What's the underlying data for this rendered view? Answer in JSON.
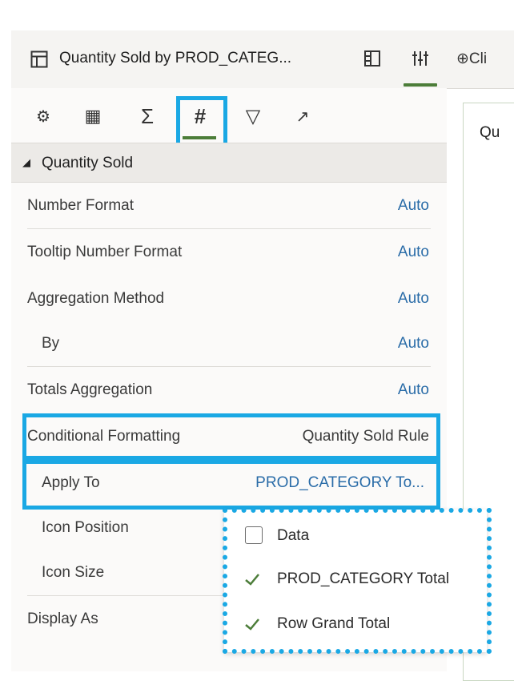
{
  "titlebar": {
    "title": "Quantity Sold by PROD_CATEG...",
    "icons": [
      "table-icon",
      "panel-layout-icon",
      "properties-sliders-icon"
    ]
  },
  "right_strip": {
    "add_text": "⊕Cli",
    "canvas_title_partial": "Qu"
  },
  "tabs": [
    {
      "icon": "gear-icon",
      "glyph": "⚙"
    },
    {
      "icon": "table-columns-icon",
      "glyph": "▦"
    },
    {
      "icon": "sigma-icon",
      "glyph": "Σ"
    },
    {
      "icon": "hash-icon",
      "glyph": "#",
      "active": true
    },
    {
      "icon": "filter-icon",
      "glyph": "▽"
    },
    {
      "icon": "trend-icon",
      "glyph": "↗"
    }
  ],
  "section": {
    "label": "Quantity Sold",
    "toggle_glyph": "◢"
  },
  "properties": [
    {
      "label": "Number Format",
      "value": "Auto"
    },
    {
      "label": "Tooltip Number Format",
      "value": "Auto"
    },
    {
      "label": "Aggregation Method",
      "value": "Auto"
    },
    {
      "label": "By",
      "value": "Auto"
    },
    {
      "label": "Totals Aggregation",
      "value": "Auto"
    },
    {
      "label": "Conditional Formatting",
      "value": "Quantity Sold Rule"
    },
    {
      "label": "Apply To",
      "value": "PROD_CATEGORY To..."
    },
    {
      "label": "Icon Position",
      "value": ""
    },
    {
      "label": "Icon Size",
      "value": ""
    },
    {
      "label": "Display As",
      "value": ""
    }
  ],
  "dropdown": {
    "items": [
      {
        "label": "Data",
        "checked": false
      },
      {
        "label": "PROD_CATEGORY Total",
        "checked": true
      },
      {
        "label": "Row Grand Total",
        "checked": true
      }
    ]
  },
  "colors": {
    "highlight": "#1aa8e4",
    "link": "#2a6ca8",
    "active_underline": "#4c7d39"
  }
}
